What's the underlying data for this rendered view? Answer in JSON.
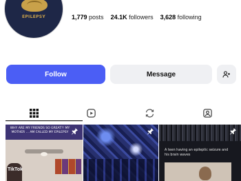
{
  "profile": {
    "avatar_text": "EPILEPSY",
    "stats": [
      {
        "value": "1,779",
        "label": "posts"
      },
      {
        "value": "24.1K",
        "label": "followers"
      },
      {
        "value": "3,628",
        "label": "following"
      }
    ]
  },
  "actions": {
    "follow_label": "Follow",
    "message_label": "Message",
    "add_person_icon": "person-add-icon"
  },
  "tabs": [
    {
      "name": "posts-grid",
      "icon": "grid-icon",
      "selected": true
    },
    {
      "name": "reels",
      "icon": "reels-icon",
      "selected": false
    },
    {
      "name": "reposts",
      "icon": "repost-icon",
      "selected": false
    },
    {
      "name": "tagged",
      "icon": "tagged-person-icon",
      "selected": false
    }
  ],
  "posts": [
    {
      "caption": "WHY ARE MY FRIENDS SO GREAT?! MY MOTHER ... AM CALLED MY EPILEPSY",
      "pinned": true,
      "overlay_text": "TikTok"
    },
    {
      "caption": "",
      "pinned": true
    },
    {
      "caption": "A teen having an epileptic seizure and his brain waves",
      "pinned": true
    }
  ],
  "colors": {
    "accent": "#4b5ef5",
    "secondary_button": "#eff0f3",
    "avatar_bg": "#1e2747"
  }
}
